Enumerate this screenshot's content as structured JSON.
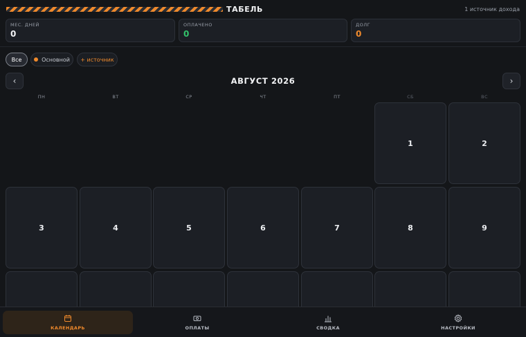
{
  "header": {
    "title": "ТАБЕЛЬ",
    "income_sources": "1 источник дохода"
  },
  "stats": [
    {
      "label": "МЕС. ДНЕЙ",
      "value": "0",
      "color": "#f2f3f5"
    },
    {
      "label": "ОПЛАЧЕНО",
      "value": "0",
      "color": "#33c26b"
    },
    {
      "label": "ДОЛГ",
      "value": "0",
      "color": "#f08a2c"
    }
  ],
  "filters": {
    "all": "Все",
    "main": "Основной",
    "add": "+ источник"
  },
  "calendar": {
    "month": "АВГУСТ 2026",
    "prev": "‹",
    "next": "›",
    "weekdays": [
      "ПН",
      "ВТ",
      "СР",
      "ЧТ",
      "ПТ",
      "СБ",
      "ВС"
    ],
    "days": [
      "1",
      "2",
      "3",
      "4",
      "5",
      "6",
      "7",
      "8",
      "9"
    ]
  },
  "bottom_nav": [
    {
      "label": "КАЛЕНДАРЬ",
      "icon": "calendar-icon"
    },
    {
      "label": "ОПЛАТЫ",
      "icon": "banknote-icon"
    },
    {
      "label": "СВОДКА",
      "icon": "bar-chart-icon"
    },
    {
      "label": "НАСТРОЙКИ",
      "icon": "gear-icon"
    }
  ],
  "colors": {
    "accent": "#f08a2c",
    "paid": "#33c26b",
    "background": "#141619",
    "card": "#1c1f25"
  }
}
